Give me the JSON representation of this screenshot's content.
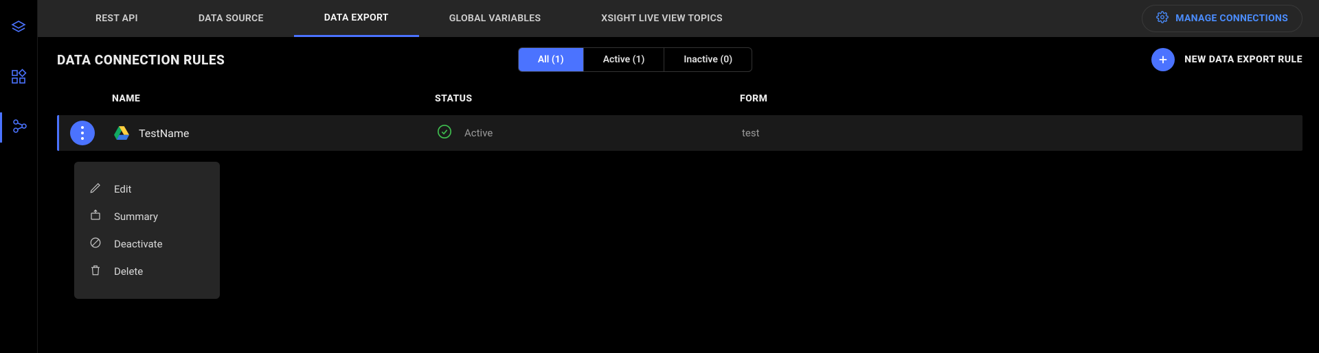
{
  "sidebar": {
    "items": [
      {
        "name": "layers-icon"
      },
      {
        "name": "dashboard-icon"
      },
      {
        "name": "connections-icon"
      }
    ],
    "active_index": 2
  },
  "tabs": [
    {
      "label": "REST API"
    },
    {
      "label": "DATA SOURCE"
    },
    {
      "label": "DATA EXPORT"
    },
    {
      "label": "GLOBAL VARIABLES"
    },
    {
      "label": "XSIGHT LIVE VIEW TOPICS"
    }
  ],
  "tabs_active_index": 2,
  "manage_button": "MANAGE CONNECTIONS",
  "page_title": "DATA CONNECTION RULES",
  "filters": [
    {
      "label": "All (1)",
      "active": true
    },
    {
      "label": "Active (1)",
      "active": false
    },
    {
      "label": "Inactive (0)",
      "active": false
    }
  ],
  "new_rule_label": "NEW DATA EXPORT RULE",
  "columns": {
    "name": "NAME",
    "status": "STATUS",
    "form": "FORM"
  },
  "rows": [
    {
      "name": "TestName",
      "status": "Active",
      "form": "test",
      "icon": "gdrive"
    }
  ],
  "context_menu": [
    {
      "icon": "pencil-icon",
      "label": "Edit"
    },
    {
      "icon": "summary-icon",
      "label": "Summary"
    },
    {
      "icon": "deactivate-icon",
      "label": "Deactivate"
    },
    {
      "icon": "trash-icon",
      "label": "Delete"
    }
  ]
}
